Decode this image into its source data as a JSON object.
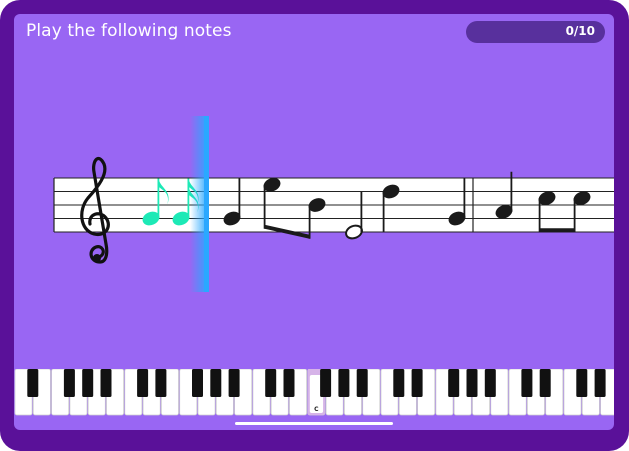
{
  "header": {
    "instruction": "Play the following notes",
    "progress_text": "0/10",
    "progress_fraction": 0
  },
  "staff": {
    "clef": "treble-clef",
    "played_color": "#1de9b6",
    "pending_color": "#1a1a1a",
    "playhead_color": "#2aa8ff",
    "notes": [
      {
        "pitch": "G4",
        "duration": "eighth",
        "state": "played"
      },
      {
        "pitch": "G4",
        "duration": "sixteenth",
        "state": "played"
      },
      {
        "pitch": "G4",
        "duration": "quarter",
        "state": "pending"
      },
      {
        "pitch": "E5",
        "duration": "eighth",
        "state": "pending",
        "beam": "start"
      },
      {
        "pitch": "B4",
        "duration": "eighth",
        "state": "pending",
        "beam": "end"
      },
      {
        "pitch": "E4",
        "duration": "half",
        "state": "pending"
      },
      {
        "pitch": "D5",
        "duration": "quarter",
        "state": "pending"
      },
      {
        "pitch": "G4",
        "duration": "quarter",
        "state": "pending"
      },
      {
        "pitch": "A4",
        "duration": "quarter",
        "state": "pending"
      },
      {
        "pitch": "C5",
        "duration": "eighth",
        "state": "pending",
        "beam": "start"
      },
      {
        "pitch": "C5",
        "duration": "eighth",
        "state": "pending",
        "beam": "end"
      }
    ]
  },
  "keyboard": {
    "middle_c_label": "C",
    "highlight_color": "#d6b3e8"
  }
}
